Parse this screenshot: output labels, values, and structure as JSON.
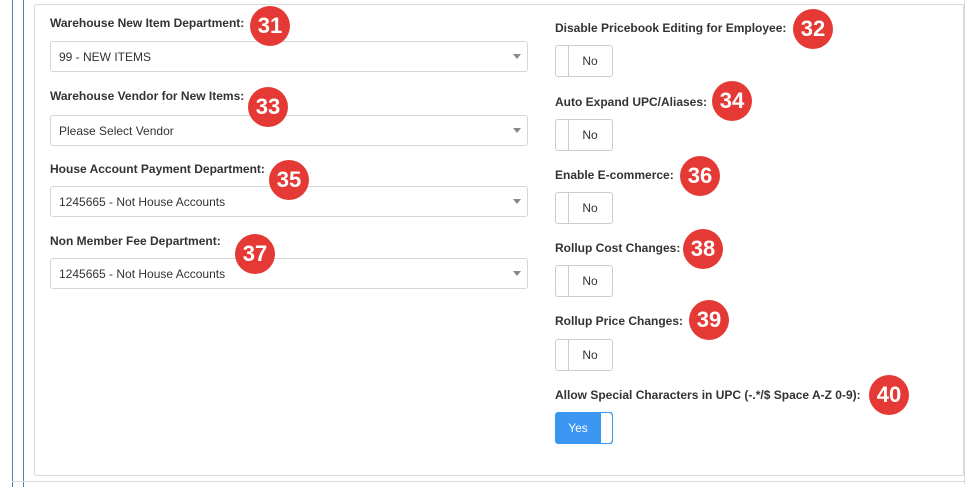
{
  "colors": {
    "accent": "#3c97f2",
    "badge": "#e53935"
  },
  "left_fields": [
    {
      "label": "Warehouse New Item Department:",
      "value": "99 - NEW ITEMS",
      "badge": "31"
    },
    {
      "label": "Warehouse Vendor for New Items:",
      "value": "Please Select Vendor",
      "badge": "33"
    },
    {
      "label": "House Account Payment Department:",
      "value": "1245665 - Not House Accounts",
      "badge": "35"
    },
    {
      "label": "Non Member Fee Department:",
      "value": "1245665 - Not House Accounts",
      "badge": "37"
    }
  ],
  "right_fields": [
    {
      "label": "Disable Pricebook Editing for Employee:",
      "value": "No",
      "badge": "32"
    },
    {
      "label": "Auto Expand UPC/Aliases:",
      "value": "No",
      "badge": "34"
    },
    {
      "label": "Enable E-commerce:",
      "value": "No",
      "badge": "36"
    },
    {
      "label": "Rollup Cost Changes:",
      "value": "No",
      "badge": "38"
    },
    {
      "label": "Rollup Price Changes:",
      "value": "No",
      "badge": "39"
    },
    {
      "label": "Allow Special Characters in UPC (-.*/$ Space A-Z 0-9):",
      "value": "Yes",
      "badge": "40"
    }
  ]
}
